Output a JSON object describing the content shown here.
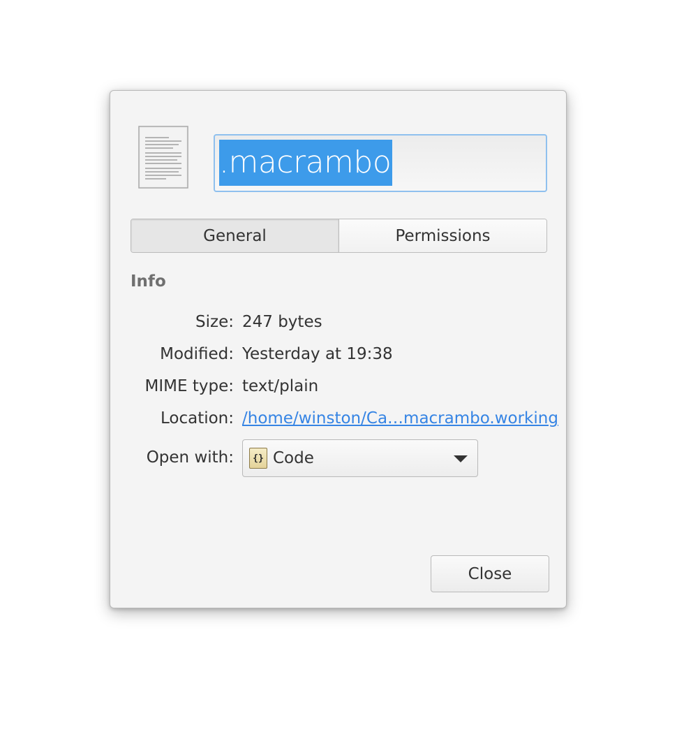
{
  "file": {
    "icon": "text-document-icon",
    "name": ".macrambo"
  },
  "tabs": [
    {
      "label": "General",
      "active": true
    },
    {
      "label": "Permissions",
      "active": false
    }
  ],
  "info": {
    "section_title": "Info",
    "size_label": "Size:",
    "size_value": "247 bytes",
    "modified_label": "Modified:",
    "modified_value": "Yesterday at 19:38",
    "mime_label": "MIME type:",
    "mime_value": "text/plain",
    "location_label": "Location:",
    "location_value": "/home/winston/Ca…macrambo.working",
    "open_with_label": "Open with:",
    "open_with_value": "Code",
    "open_with_icon": "code-editor-icon"
  },
  "buttons": {
    "close_label": "Close"
  },
  "colors": {
    "selection": "#3d9bea",
    "link": "#3584e4",
    "focus_border": "#8fc0ee"
  }
}
